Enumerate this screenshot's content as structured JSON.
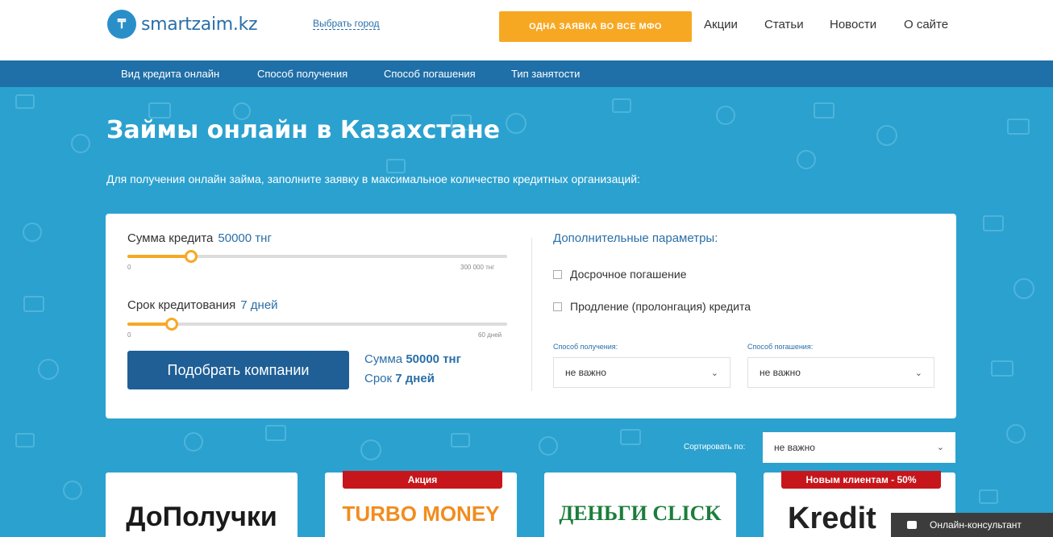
{
  "header": {
    "logo_text": "smartzaim.kz",
    "city_link": "Выбрать город",
    "cta_button": "ОДНА ЗАЯВКА ВО ВСЕ МФО",
    "nav": [
      "Акции",
      "Статьи",
      "Новости",
      "О сайте"
    ]
  },
  "subnav": [
    "Вид кредита онлайн",
    "Способ получения",
    "Способ погашения",
    "Тип занятости"
  ],
  "hero": {
    "title": "Займы онлайн в Казахстане",
    "subtitle": "Для получения онлайн займа, заполните заявку в максимальное количество кредитных организаций:"
  },
  "calculator": {
    "amount_label": "Сумма кредита",
    "amount_value": "50000 тнг",
    "amount_min": "0",
    "amount_max": "300 000 тнг",
    "amount_fraction": 0.1667,
    "term_label": "Срок кредитования",
    "term_value": "7 дней",
    "term_min": "0",
    "term_max": "60 дней",
    "term_fraction": 0.1167,
    "submit_button": "Подобрать компании",
    "summary_amount_label": "Сумма",
    "summary_amount_value": "50000 тнг",
    "summary_term_label": "Срок",
    "summary_term_value": "7 дней"
  },
  "params": {
    "title": "Дополнительные параметры:",
    "checkbox_early": "Досрочное погашение",
    "checkbox_extension": "Продление (пролонгация) кредита",
    "receive_label": "Способ получения:",
    "receive_value": "не важно",
    "repay_label": "Способ погашения:",
    "repay_value": "не важно"
  },
  "sort": {
    "label": "Сортировать по:",
    "value": "не важно"
  },
  "offers": [
    {
      "badge": "",
      "logo": "ДоПолучки",
      "color": "#1a1a1a"
    },
    {
      "badge": "Акция",
      "logo": "TURBO MONEY",
      "color": "#f28c1e"
    },
    {
      "badge": "",
      "logo": "ДЕНЬГИ CLICK",
      "color": "#1c7d3c"
    },
    {
      "badge": "Новым клиентам - 50%",
      "logo": "Kredit",
      "color": "#222222"
    }
  ],
  "consultant": "Онлайн-консультант",
  "colors": {
    "accent": "#f7a823",
    "primary": "#1f5f96",
    "hero_bg": "#2ba1cf",
    "badge": "#c7161b"
  }
}
